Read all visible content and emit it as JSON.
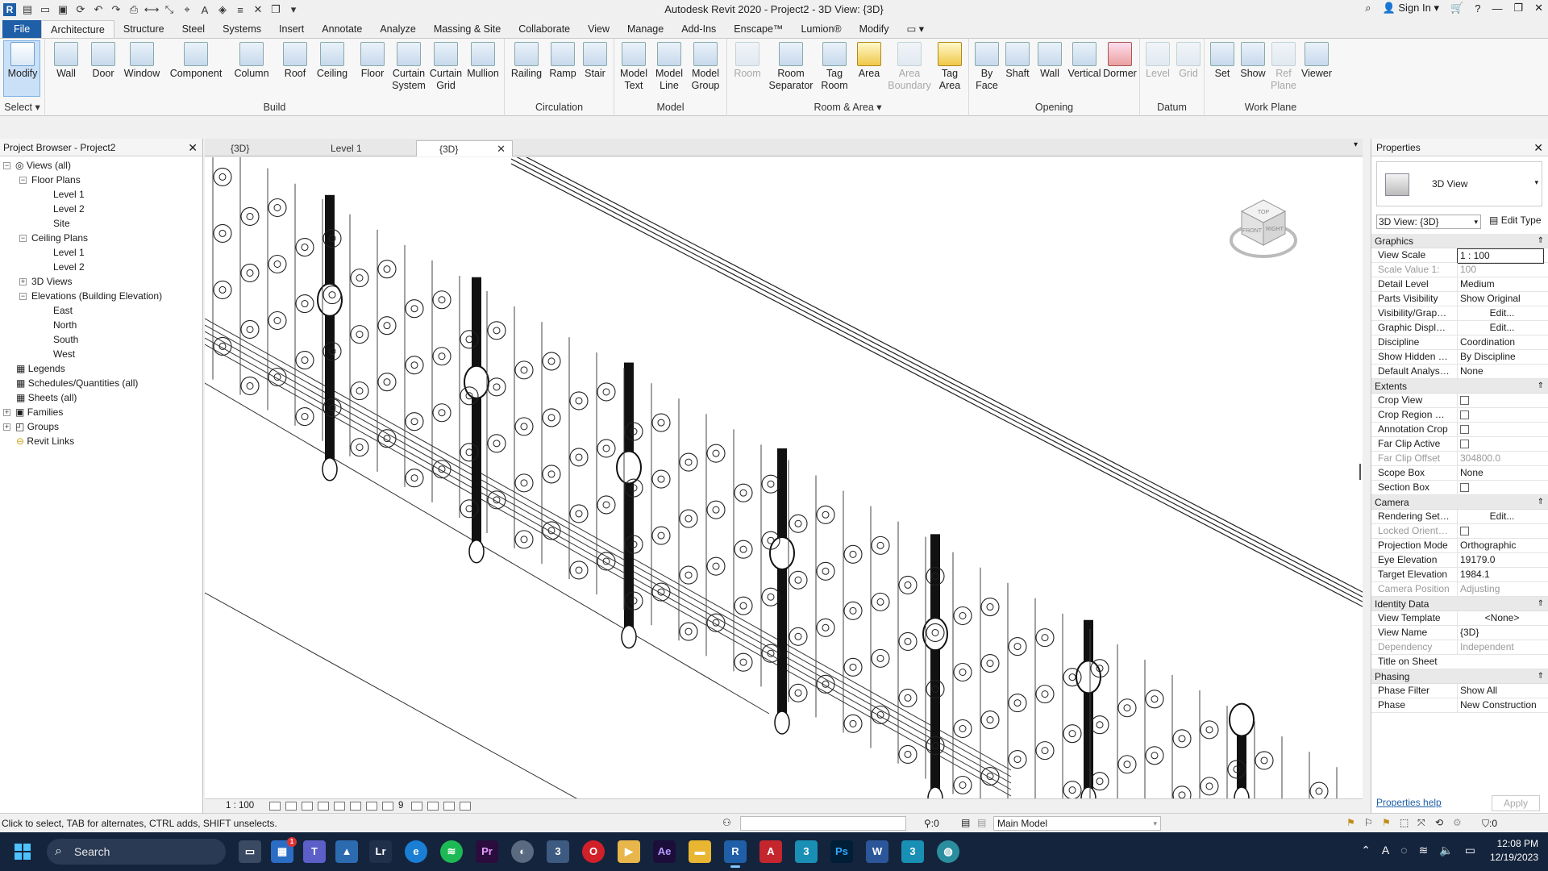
{
  "window": {
    "title": "Autodesk Revit 2020 - Project2 - 3D View: {3D}",
    "sign_in": "Sign In"
  },
  "menu": [
    "File",
    "Architecture",
    "Structure",
    "Steel",
    "Systems",
    "Insert",
    "Annotate",
    "Analyze",
    "Massing & Site",
    "Collaborate",
    "View",
    "Manage",
    "Add-Ins",
    "Enscape™",
    "Lumion®",
    "Modify"
  ],
  "ribbon": {
    "select_label": "Select",
    "groups": {
      "build": "Build",
      "circulation": "Circulation",
      "model": "Model",
      "room_area": "Room & Area",
      "opening": "Opening",
      "datum": "Datum",
      "work_plane": "Work Plane"
    },
    "buttons": {
      "modify": "Modify",
      "wall": "Wall",
      "door": "Door",
      "window": "Window",
      "component": "Component",
      "column": "Column",
      "roof": "Roof",
      "ceiling": "Ceiling",
      "floor": "Floor",
      "curtain_system": "Curtain\nSystem",
      "curtain_grid": "Curtain\nGrid",
      "mullion": "Mullion",
      "railing": "Railing",
      "ramp": "Ramp",
      "stair": "Stair",
      "model_text": "Model\nText",
      "model_line": "Model\nLine",
      "model_group": "Model\nGroup",
      "room": "Room",
      "room_separator": "Room\nSeparator",
      "tag_room": "Tag\nRoom",
      "area": "Area",
      "area_boundary": "Area\nBoundary",
      "tag_area": "Tag\nArea",
      "by_face": "By\nFace",
      "shaft": "Shaft",
      "wall_open": "Wall",
      "vertical": "Vertical",
      "dormer": "Dormer",
      "level": "Level",
      "grid": "Grid",
      "set": "Set",
      "show": "Show",
      "ref_plane": "Ref\nPlane",
      "viewer": "Viewer"
    }
  },
  "project_browser": {
    "title": "Project Browser - Project2",
    "items": [
      "Views (all)",
      "Floor Plans",
      "Level 1",
      "Level 2",
      "Site",
      "Ceiling Plans",
      "Level 1",
      "Level 2",
      "3D Views",
      "Elevations (Building Elevation)",
      "East",
      "North",
      "South",
      "West",
      "Legends",
      "Schedules/Quantities (all)",
      "Sheets (all)",
      "Families",
      "Groups",
      "Revit Links"
    ]
  },
  "view_tabs": [
    "{3D}",
    "Level 1",
    "{3D}"
  ],
  "view_bar": {
    "scale": "1 : 100",
    "detail": "9"
  },
  "viewcube": {
    "top": "TOP",
    "front": "FRONT",
    "right": "RIGHT"
  },
  "properties": {
    "title": "Properties",
    "type_name": "3D View",
    "instance_selector": "3D View: {3D}",
    "edit_type": "Edit Type",
    "categories": [
      {
        "name": "Graphics",
        "rows": [
          [
            "View Scale",
            "1 : 100"
          ],
          [
            "Scale Value    1:",
            "100"
          ],
          [
            "Detail Level",
            "Medium"
          ],
          [
            "Parts Visibility",
            "Show Original"
          ],
          [
            "Visibility/Graphi...",
            "Edit..."
          ],
          [
            "Graphic Display...",
            "Edit..."
          ],
          [
            "Discipline",
            "Coordination"
          ],
          [
            "Show Hidden Li...",
            "By Discipline"
          ],
          [
            "Default Analysis...",
            "None"
          ]
        ]
      },
      {
        "name": "Extents",
        "rows": [
          [
            "Crop View",
            ""
          ],
          [
            "Crop Region Vis...",
            ""
          ],
          [
            "Annotation Crop",
            ""
          ],
          [
            "Far Clip Active",
            ""
          ],
          [
            "Far Clip Offset",
            "304800.0"
          ],
          [
            "Scope Box",
            "None"
          ],
          [
            "Section Box",
            ""
          ]
        ]
      },
      {
        "name": "Camera",
        "rows": [
          [
            "Rendering Setti...",
            "Edit..."
          ],
          [
            "Locked Orientat...",
            ""
          ],
          [
            "Projection Mode",
            "Orthographic"
          ],
          [
            "Eye Elevation",
            "19179.0"
          ],
          [
            "Target Elevation",
            "1984.1"
          ],
          [
            "Camera Position",
            "Adjusting"
          ]
        ]
      },
      {
        "name": "Identity Data",
        "rows": [
          [
            "View Template",
            "<None>"
          ],
          [
            "View Name",
            "{3D}"
          ],
          [
            "Dependency",
            "Independent"
          ],
          [
            "Title on Sheet",
            ""
          ]
        ]
      },
      {
        "name": "Phasing",
        "rows": [
          [
            "Phase Filter",
            "Show All"
          ],
          [
            "Phase",
            "New Construction"
          ]
        ]
      }
    ],
    "help": "Properties help",
    "apply": "Apply"
  },
  "status": {
    "text": "Click to select, TAB for alternates, CTRL adds, SHIFT unselects.",
    "sel_count": ":0",
    "workset": "Main Model",
    "filter_count": ":0"
  },
  "taskbar": {
    "search": "Search",
    "time": "12:08 PM",
    "date": "12/19/2023",
    "badge": "1"
  }
}
